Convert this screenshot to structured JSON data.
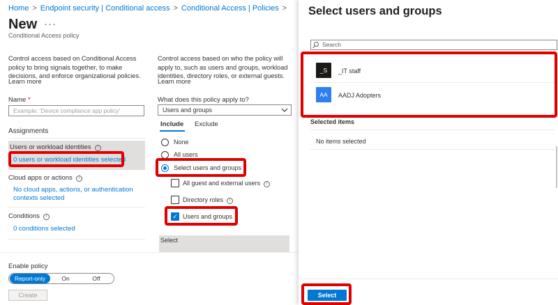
{
  "breadcrumbs": [
    "Home",
    "Endpoint security | Conditional access",
    "Conditional Access | Policies"
  ],
  "breadcrumb_separator": ">",
  "page": {
    "title": "New",
    "more_glyph": "···",
    "subtitle": "Conditional Access policy"
  },
  "left": {
    "description": "Control access based on Conditional Access policy to bring signals together, to make decisions, and enforce organizational policies.",
    "learn_more": "Learn more",
    "name_label": "Name",
    "name_required": "*",
    "name_placeholder": "Example: 'Device compliance app policy'",
    "assignments_heading": "Assignments",
    "users_label": "Users or workload identities",
    "users_value": "0 users or workload identities selected",
    "cloud_label": "Cloud apps or actions",
    "cloud_value": "No cloud apps, actions, or authentication contexts selected",
    "conditions_label": "Conditions",
    "conditions_value": "0 conditions selected"
  },
  "middle": {
    "description": "Control access based on who the policy will apply to, such as users and groups, workload identities, directory roles, or external guests.",
    "learn_more": "Learn more",
    "applies_label": "What does this policy apply to?",
    "applies_value": "Users and groups",
    "tabs": [
      "Include",
      "Exclude"
    ],
    "radio_options": [
      "None",
      "All users",
      "Select users and groups"
    ],
    "checkbox_options": [
      "All guest and external users",
      "Directory roles",
      "Users and groups"
    ],
    "select_label": "Select"
  },
  "footer": {
    "enable_label": "Enable policy",
    "toggle_options": [
      "Report-only",
      "On",
      "Off"
    ],
    "create_label": "Create"
  },
  "panel": {
    "title": "Select users and groups",
    "search_placeholder": "Search",
    "results": [
      {
        "initials": "_S",
        "name": "_IT staff",
        "color": "#1b1a19"
      },
      {
        "initials": "AA",
        "name": "AADJ Adopters",
        "color": "#2f7ff0"
      }
    ],
    "selected_heading": "Selected items",
    "no_items": "No items selected",
    "select_button": "Select"
  },
  "colors": {
    "accent": "#0078d4",
    "highlight": "#e00000"
  }
}
